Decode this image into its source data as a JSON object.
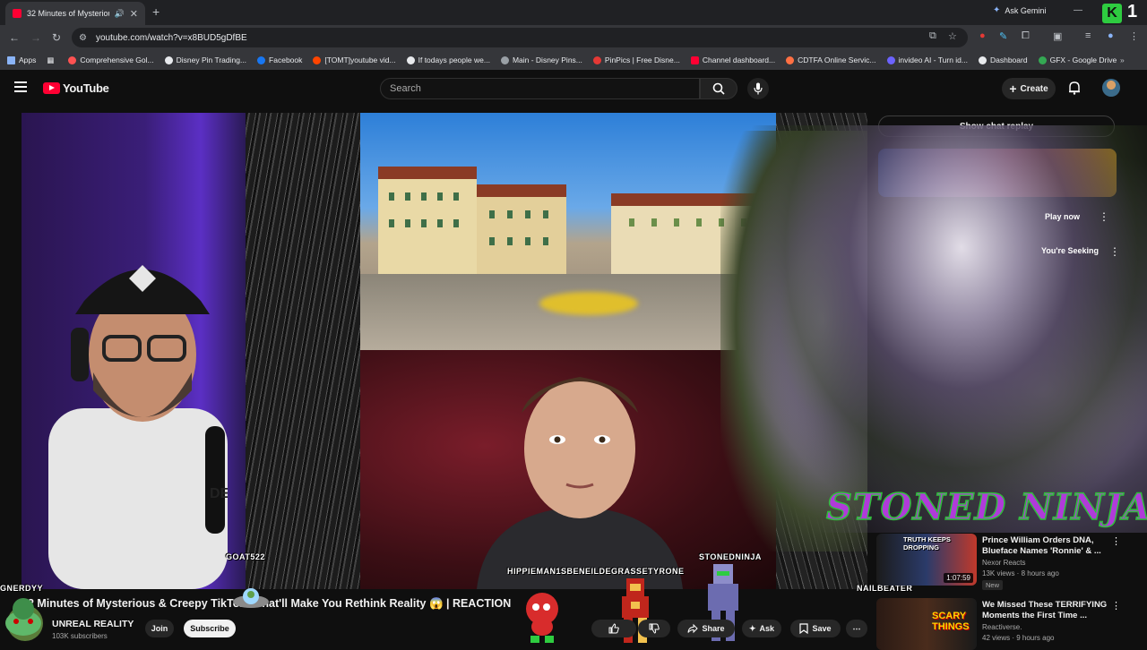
{
  "browser": {
    "tab_title": "32 Minutes of Mysterious &",
    "url": "youtube.com/watch?v=x8BUD5gDfBE",
    "ask_gemini": "Ask Gemini",
    "bookmarks": [
      {
        "label": "Apps",
        "color": "#8ab4f8"
      },
      {
        "label": "Comprehensive Gol...",
        "color": "#ff5252"
      },
      {
        "label": "Disney Pin Trading...",
        "color": "#e8eaed"
      },
      {
        "label": "Facebook",
        "color": "#1877f2"
      },
      {
        "label": "[TOMT]youtube vid...",
        "color": "#ff4500"
      },
      {
        "label": "If todays people we...",
        "color": "#e8eaed"
      },
      {
        "label": "Main - Disney Pins...",
        "color": "#9aa0a6"
      },
      {
        "label": "PinPics | Free Disne...",
        "color": "#e53935"
      },
      {
        "label": "Channel dashboard...",
        "color": "#ff0033"
      },
      {
        "label": "CDTFA Online Servic...",
        "color": "#ff7043"
      },
      {
        "label": "invideo AI - Turn id...",
        "color": "#6c63ff"
      },
      {
        "label": "Dashboard",
        "color": "#e8eaed"
      },
      {
        "label": "GFX - Google Drive",
        "color": "#34a853"
      }
    ]
  },
  "header": {
    "logo_text": "YouTube",
    "search_placeholder": "Search",
    "create_label": "Create"
  },
  "video": {
    "labels": {
      "goat": "GOAT522",
      "hippie": "HIPPIEMAN1SBENEILDEGRASSETYRONE",
      "stonedninja": "STONEDNINJA",
      "nailbeater": "NAILBEATER",
      "energy": "GNERDYY"
    },
    "title": "32 Minutes of Mysterious & Creepy TikToks That'll Make You Rethink Reality 😱 | REACTION",
    "stoned_ninja": "STONED NINJA"
  },
  "channel": {
    "name": "UNREAL REALITY",
    "subscribers": "103K subscribers",
    "join": "Join",
    "subscribe": "Subscribe"
  },
  "actions": {
    "share": "Share",
    "ask": "Ask",
    "save": "Save"
  },
  "sidebar": {
    "chat_replay": "Show chat replay",
    "ad_play_now": "Play now",
    "ad_seeking": "You're Seeking",
    "recs": [
      {
        "title": "Prince William Orders DNA, Blueface Names 'Ronnie' & ...",
        "channel": "Nexor Reacts",
        "meta": "13K views · 8 hours ago",
        "badge": "New",
        "duration": "1:07:59",
        "thumb_text": "TRUTH KEEPS DROPPING"
      },
      {
        "title": "We Missed These TERRIFYING Moments the First Time ...",
        "channel": "Reactiverse.",
        "meta": "42 views · 9 hours ago",
        "badge": "",
        "duration": "",
        "thumb_text": "SCARY THINGS"
      }
    ]
  }
}
